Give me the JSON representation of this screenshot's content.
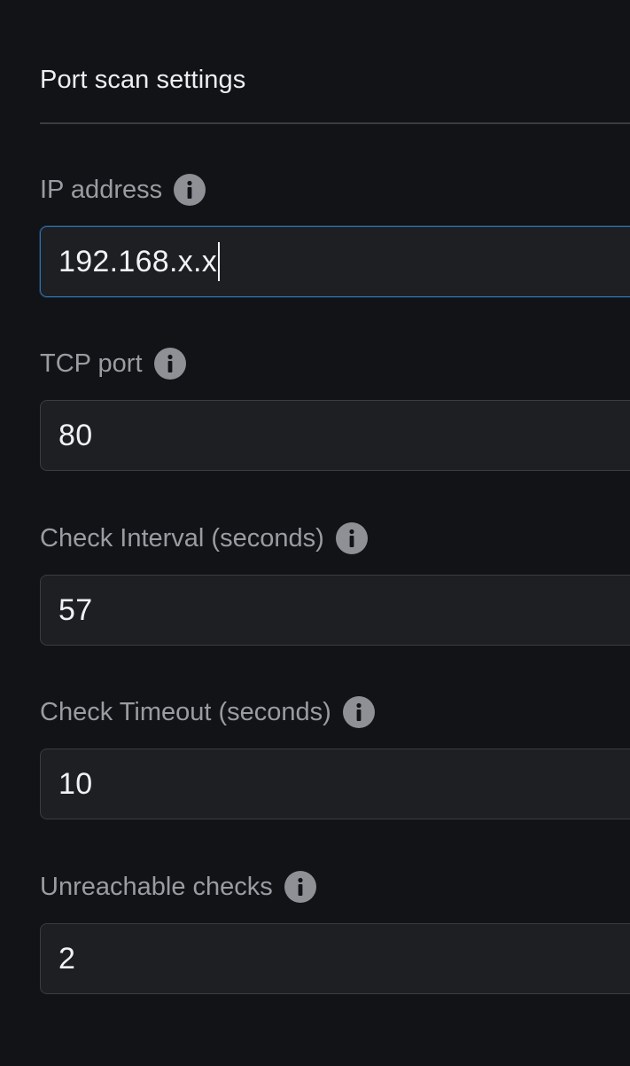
{
  "section": {
    "title": "Port scan settings"
  },
  "fields": [
    {
      "label": "IP address",
      "value": "192.168.x.x",
      "focused": true
    },
    {
      "label": "TCP port",
      "value": "80"
    },
    {
      "label": "Check Interval (seconds)",
      "value": "57"
    },
    {
      "label": "Check Timeout (seconds)",
      "value": "10"
    },
    {
      "label": "Unreachable checks",
      "value": "2"
    }
  ],
  "icons": {
    "info": "info-icon"
  },
  "colors": {
    "background": "#121316",
    "input_background": "#1e1f23",
    "focus_border": "#2f6fb0",
    "label_text": "#9a9ca2",
    "icon_fill": "#8e9096"
  }
}
